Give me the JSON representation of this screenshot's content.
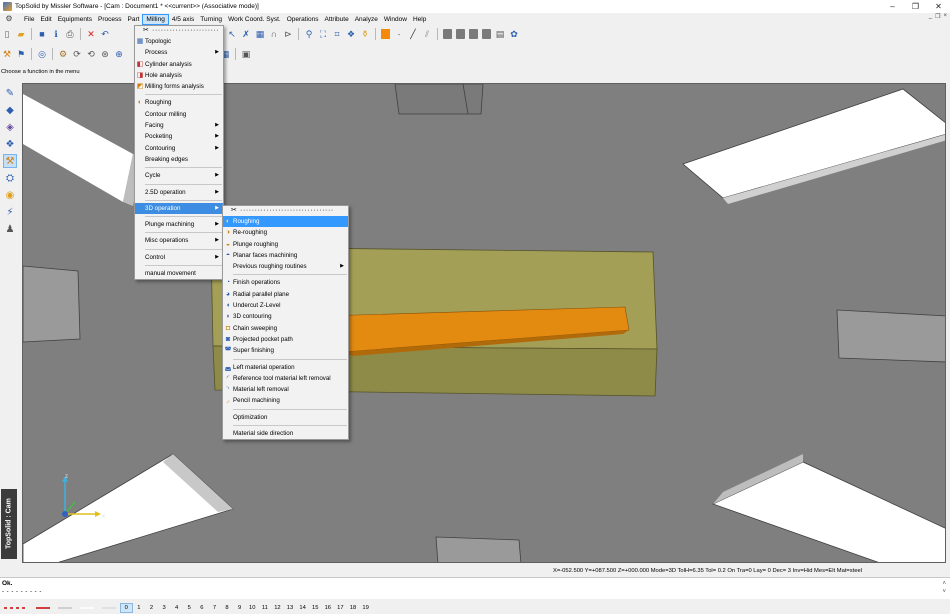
{
  "window": {
    "title": "TopSolid by Missler Software - [Cam : Document1 * <<current>> (Associative mode)]",
    "controls": [
      "–",
      "❐",
      "✕"
    ],
    "mdi_controls": [
      "_",
      "❐",
      "×"
    ]
  },
  "menubar": {
    "items": [
      "File",
      "Edit",
      "Equipments",
      "Process",
      "Part",
      "Milling",
      "4/5 axis",
      "Turning",
      "Work Coord. Syst.",
      "Operations",
      "Attribute",
      "Analyze",
      "Window",
      "Help"
    ],
    "active": "Milling"
  },
  "prompt": "Choose a function in the menu",
  "vertical_tab": "TopSolid : Cam",
  "milling_menu": {
    "tearoff": "✂ ·······················",
    "items": [
      {
        "label": "Topologic",
        "icon": "topologic-icon",
        "glyph": "▦",
        "submenu": false
      },
      {
        "label": "Process",
        "icon": "",
        "glyph": "",
        "submenu": true
      },
      {
        "label": "Cylinder analysis",
        "icon": "cylinder-analysis-icon",
        "glyph": "◧",
        "submenu": false
      },
      {
        "label": "Hole analysis",
        "icon": "hole-analysis-icon",
        "glyph": "◨",
        "submenu": false
      },
      {
        "label": "Milling forms analysis",
        "icon": "milling-forms-icon",
        "glyph": "◩",
        "submenu": false
      }
    ],
    "items2": [
      {
        "label": "Roughing",
        "icon": "roughing-icon",
        "glyph": "◐",
        "submenu": false
      },
      {
        "label": "Contour milling",
        "submenu": false
      },
      {
        "label": "Facing",
        "submenu": true
      },
      {
        "label": "Pocketing",
        "submenu": true
      },
      {
        "label": "Contouring",
        "submenu": true
      },
      {
        "label": "Breaking edges",
        "submenu": false
      }
    ],
    "items3": [
      {
        "label": "Cycle",
        "submenu": true
      }
    ],
    "items4": [
      {
        "label": "2.5D operation",
        "submenu": true
      }
    ],
    "items5": [
      {
        "label": "3D operation",
        "submenu": true
      }
    ],
    "items6": [
      {
        "label": "Plunge machining",
        "submenu": true
      }
    ],
    "items7": [
      {
        "label": "Misc operations",
        "submenu": true
      }
    ],
    "items8": [
      {
        "label": "Control",
        "submenu": true
      }
    ],
    "items9": [
      {
        "label": "manual movement",
        "submenu": false
      }
    ],
    "highlighted": "3D operation"
  },
  "submenu_3d": {
    "tearoff": "✂ ································",
    "group1": [
      {
        "label": "Roughing",
        "icon": "roughing-icon",
        "glyph": "◐",
        "submenu": false,
        "highlighted": true
      },
      {
        "label": "Re-roughing",
        "icon": "reroughing-icon",
        "glyph": "◑",
        "submenu": false
      },
      {
        "label": "Plunge roughing",
        "icon": "plunge-roughing-icon",
        "glyph": "◒",
        "submenu": false
      },
      {
        "label": "Planar faces machining",
        "icon": "planar-faces-icon",
        "glyph": "◓",
        "submenu": false
      },
      {
        "label": "Previous roughing routines",
        "icon": "",
        "glyph": "",
        "submenu": true
      }
    ],
    "group2": [
      {
        "label": "Finish operations",
        "icon": "finish-icon",
        "glyph": "◔",
        "submenu": false
      },
      {
        "label": "Radial parallel plane",
        "icon": "radial-plane-icon",
        "glyph": "◕",
        "submenu": false
      },
      {
        "label": "Undercut Z-Level",
        "icon": "undercut-icon",
        "glyph": "◖",
        "submenu": false
      },
      {
        "label": "3D contouring",
        "icon": "contouring-3d-icon",
        "glyph": "◗",
        "submenu": false
      },
      {
        "label": "Chain sweeping",
        "icon": "chain-sweeping-icon",
        "glyph": "◘",
        "submenu": false
      },
      {
        "label": "Projected pocket path",
        "icon": "projected-pocket-icon",
        "glyph": "◙",
        "submenu": false
      },
      {
        "label": "Super finishing",
        "icon": "super-finishing-icon",
        "glyph": "◚",
        "submenu": false
      }
    ],
    "group3": [
      {
        "label": "Left material operation",
        "icon": "left-material-icon",
        "glyph": "◛",
        "submenu": false
      },
      {
        "label": "Reference tool material left removal",
        "icon": "reference-tool-icon",
        "glyph": "◜",
        "submenu": false
      },
      {
        "label": "Material left removal",
        "icon": "material-removal-icon",
        "glyph": "◝",
        "submenu": false
      },
      {
        "label": "Pencil machining",
        "icon": "pencil-machining-icon",
        "glyph": "◞",
        "submenu": false
      }
    ],
    "group4": [
      {
        "label": "Optimization",
        "submenu": false
      }
    ],
    "group5": [
      {
        "label": "Material side direction",
        "submenu": false
      }
    ]
  },
  "status": {
    "coords": "X=-052.500  Y=+087.500  Z=+000.000  Mode=3D  TolH=6.35   Tol=  0.2    On  Tra=0   Lay=  0   Dec= 3   Inv=Hid  Mes=Elt  Mat=steel",
    "message": "Ok.",
    "message_line2": "- - - - - - - - -"
  },
  "layers": {
    "numbers": [
      "0",
      "1",
      "2",
      "3",
      "4",
      "5",
      "6",
      "7",
      "8",
      "9",
      "10",
      "11",
      "12",
      "13",
      "14",
      "15",
      "16",
      "17",
      "18",
      "19"
    ],
    "current": "0"
  },
  "axes": {
    "x": "x",
    "y": "y",
    "z": "z"
  },
  "colors": {
    "viewport_bg": "#808080",
    "stock": "#9e9a4a",
    "part": "#d98c14",
    "menu_highlight": "#3d8ee3"
  }
}
